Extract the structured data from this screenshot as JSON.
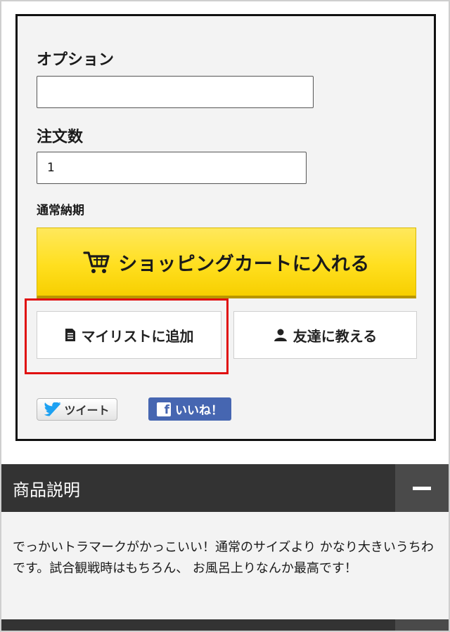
{
  "form": {
    "option_label": "オプション",
    "option_value": "",
    "quantity_label": "注文数",
    "quantity_value": "1",
    "delivery_label": "通常納期"
  },
  "buttons": {
    "cart": "ショッピングカートに入れる",
    "mylist": "マイリストに追加",
    "tell_friend": "友達に教える",
    "tweet": "ツイート",
    "like": "いいね！"
  },
  "icons": {
    "cart": "shopping-cart-icon",
    "mylist": "document-icon",
    "friend": "person-icon",
    "twitter": "twitter-bird-icon",
    "facebook": "facebook-f-icon",
    "collapse": "minus-icon"
  },
  "colors": {
    "cart_button": "#ffdf1f",
    "highlight": "#e01010",
    "section_bar": "#333333",
    "facebook": "#4666b1",
    "twitter": "#1da1f2"
  },
  "description": {
    "title": "商品説明",
    "text": "でっかいトラマークがかっこいい！通常のサイズより かなり大きいうちわです。試合観戦時はもちろん、 お風呂上りなんか最高です！"
  }
}
